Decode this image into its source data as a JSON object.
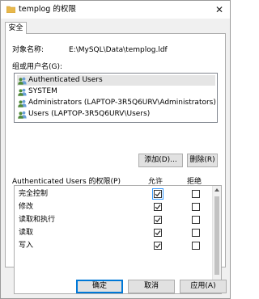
{
  "window": {
    "title": "templog 的权限",
    "close_glyph": "✕"
  },
  "tabs": [
    {
      "label": "安全"
    }
  ],
  "object": {
    "label": "对象名称:",
    "value": "E:\\MySQL\\Data\\templog.ldf"
  },
  "groups": {
    "label": "组或用户名(G):",
    "items": [
      {
        "label": "Authenticated Users",
        "icon": "users-icon"
      },
      {
        "label": "SYSTEM",
        "icon": "users-icon"
      },
      {
        "label": "Administrators (LAPTOP-3R5Q6URV\\Administrators)",
        "icon": "users-icon"
      },
      {
        "label": "Users (LAPTOP-3R5Q6URV\\Users)",
        "icon": "users-icon"
      }
    ],
    "selected_index": 0
  },
  "buttons": {
    "add": "添加(D)...",
    "remove": "删除(R)",
    "ok": "确定",
    "cancel": "取消",
    "apply": "应用(A)"
  },
  "permissions": {
    "header": "Authenticated Users 的权限(P)",
    "allow_header": "允许",
    "deny_header": "拒绝",
    "rows": [
      {
        "name": "完全控制",
        "allow": true,
        "deny": false
      },
      {
        "name": "修改",
        "allow": true,
        "deny": false
      },
      {
        "name": "读取和执行",
        "allow": true,
        "deny": false
      },
      {
        "name": "读取",
        "allow": true,
        "deny": false
      },
      {
        "name": "写入",
        "allow": true,
        "deny": false
      }
    ]
  },
  "colors": {
    "accent": "#0078d7",
    "folder": "#e8b84b",
    "selection": "#e5e5e5"
  }
}
